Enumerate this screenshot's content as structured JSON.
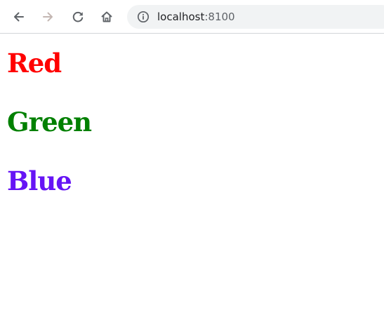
{
  "browser": {
    "address_bar": {
      "host": "localhost",
      "port": ":8100"
    },
    "icons": {
      "back": "arrow-left-icon",
      "forward": "arrow-right-icon",
      "reload": "reload-icon",
      "home": "home-icon",
      "site_info": "info-icon"
    },
    "colors": {
      "icon_active": "#5f6368",
      "icon_disabled": "#c4b7b3",
      "omnibox_bg": "#f1f3f4"
    }
  },
  "page": {
    "headings": [
      {
        "text": "Red",
        "color": "#ff0000"
      },
      {
        "text": "Green",
        "color": "#008000"
      },
      {
        "text": "Blue",
        "color": "#6614f5"
      }
    ]
  }
}
